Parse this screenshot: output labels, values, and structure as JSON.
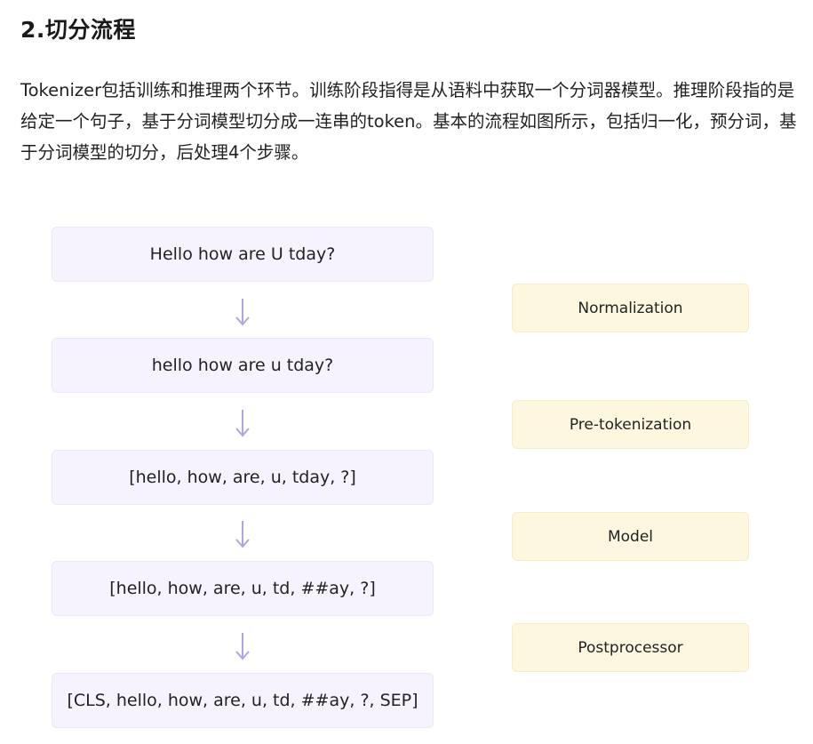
{
  "heading": "2.切分流程",
  "paragraph": "Tokenizer包括训练和推理两个环节。训练阶段指得是从语料中获取一个分词器模型。推理阶段指的是给定一个句子，基于分词模型切分成一连串的token。基本的流程如图所示，包括归一化，预分词，基于分词模型的切分，后处理4个步骤。",
  "diagram": {
    "stages": [
      "Hello how are U tday?",
      "hello how are u tday?",
      "[hello, how, are, u, tday, ?]",
      "[hello, how, are, u, td, ##ay, ?]",
      "[CLS, hello, how, are, u, td, ##ay, ?, SEP]"
    ],
    "steps": [
      "Normalization",
      "Pre-tokenization",
      "Model",
      "Postprocessor"
    ],
    "arrow_icon": "arrow-down-icon",
    "colors": {
      "stage_bg": "#f6f3fe",
      "step_bg": "#fdf7df",
      "arrow": "#b3a3e6"
    }
  }
}
